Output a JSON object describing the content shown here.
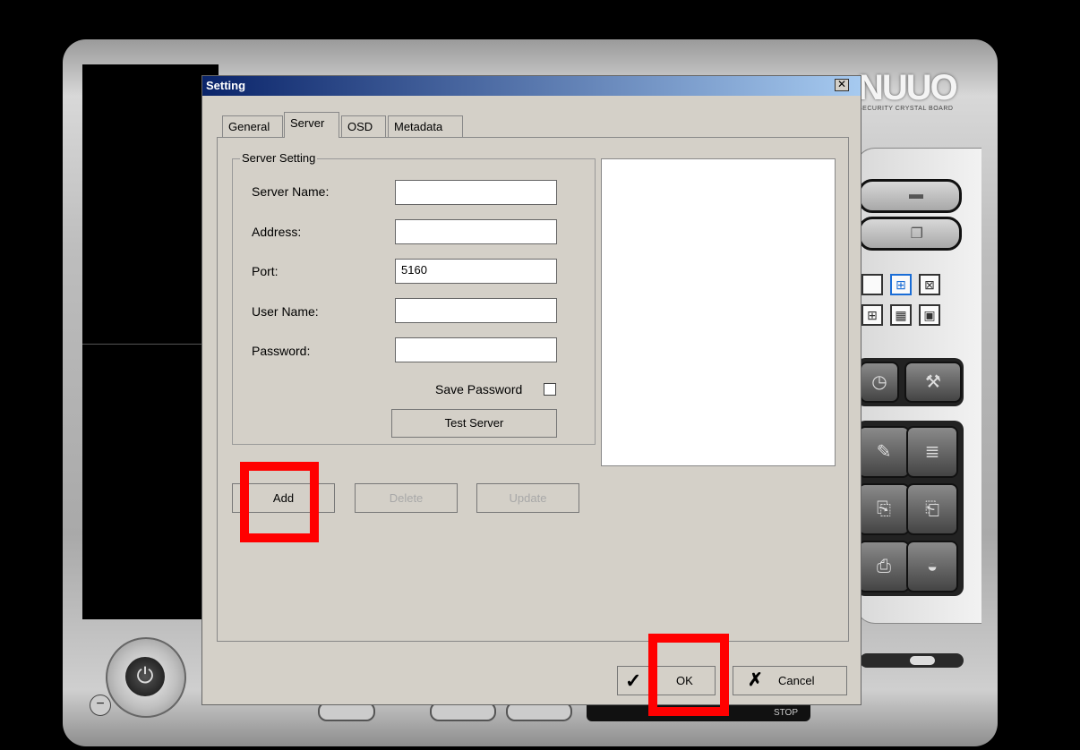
{
  "dialog": {
    "title": "Setting",
    "close_glyph": "✕",
    "tabs": [
      {
        "label": "General",
        "active": false
      },
      {
        "label": "Server",
        "active": true
      },
      {
        "label": "OSD",
        "active": false
      },
      {
        "label": "Metadata",
        "active": false
      }
    ],
    "group_title": "Server Setting",
    "fields": {
      "server_name": {
        "label": "Server Name:",
        "value": ""
      },
      "address": {
        "label": "Address:",
        "value": ""
      },
      "port": {
        "label": "Port:",
        "value": "5160"
      },
      "user_name": {
        "label": "User Name:",
        "value": ""
      },
      "password": {
        "label": "Password:",
        "value": ""
      }
    },
    "save_password_label": "Save Password",
    "test_server_label": "Test Server",
    "add_label": "Add",
    "delete_label": "Delete",
    "update_label": "Update",
    "ok_label": "OK",
    "cancel_label": "Cancel",
    "ok_glyph": "✓",
    "cancel_glyph": "✗"
  },
  "background": {
    "logo_text": "NUUO",
    "logo_tagline": "SECURITY CRYSTAL BOARD",
    "stop_label": "STOP"
  },
  "icons": {
    "folder": "folder-icon",
    "copy": "copy-icon",
    "clock": "clock-icon",
    "hammer": "hammer-icon",
    "power": "power-icon"
  },
  "highlight_color": "#ff0000"
}
